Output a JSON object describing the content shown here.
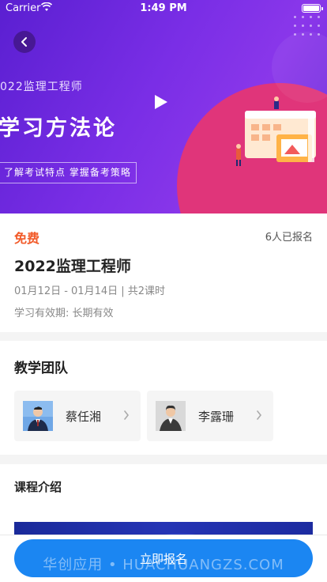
{
  "status_bar": {
    "carrier": "Carrier",
    "time": "1:49 PM"
  },
  "banner": {
    "subtitle": "022监理工程师",
    "title": "学习方法论",
    "tagline": "了解考试特点 掌握备考策略"
  },
  "course": {
    "price": "免费",
    "enrolled": "6人已报名",
    "title": "2022监理工程师",
    "dates": "01月12日 - 01月14日 | 共2课时",
    "validity": "学习有效期: 长期有效"
  },
  "team": {
    "title": "教学团队",
    "teachers": [
      {
        "name": "蔡任湘"
      },
      {
        "name": "李露珊"
      }
    ]
  },
  "intro": {
    "title": "课程介绍"
  },
  "bottom": {
    "enroll_button": "立即报名"
  },
  "watermark": "华创应用 • HUACHUANGZS.COM",
  "colors": {
    "accent_orange": "#f25b2a",
    "primary_blue": "#1b86f2",
    "banner_purple": "#7a2ee6",
    "banner_pink": "#e0357a"
  }
}
